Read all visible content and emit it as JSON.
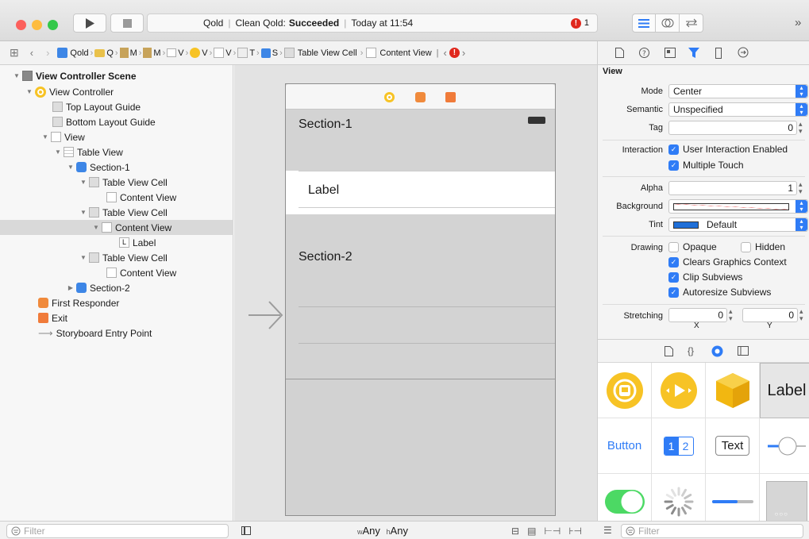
{
  "toolbar": {
    "scheme": "Qold",
    "status_prefix": "Clean Qold:",
    "status_result": "Succeeded",
    "status_time": "Today at 11:54",
    "error_count": "1",
    "more": "»"
  },
  "jumpbar": {
    "items": [
      "Qold",
      "Q",
      "M",
      "M",
      "V",
      "V",
      "V",
      "T",
      "S",
      "Table View Cell",
      "Content View"
    ]
  },
  "outline": {
    "rows": [
      {
        "label": "View Controller Scene",
        "bold": true
      },
      {
        "label": "View Controller"
      },
      {
        "label": "Top Layout Guide"
      },
      {
        "label": "Bottom Layout Guide"
      },
      {
        "label": "View"
      },
      {
        "label": "Table View"
      },
      {
        "label": "Section-1"
      },
      {
        "label": "Table View Cell"
      },
      {
        "label": "Content View"
      },
      {
        "label": "Table View Cell"
      },
      {
        "label": "Content View"
      },
      {
        "label": "Label"
      },
      {
        "label": "Table View Cell"
      },
      {
        "label": "Content View"
      },
      {
        "label": "Section-2"
      },
      {
        "label": "First Responder"
      },
      {
        "label": "Exit"
      },
      {
        "label": "Storyboard Entry Point"
      }
    ],
    "filter_placeholder": "Filter"
  },
  "canvas": {
    "section1": "Section-1",
    "cell_label": "Label",
    "section2": "Section-2",
    "size_class_w": "w",
    "size_class_w_value": "Any",
    "size_class_h": "h",
    "size_class_h_value": "Any"
  },
  "inspector": {
    "header": "View",
    "mode_label": "Mode",
    "mode_value": "Center",
    "semantic_label": "Semantic",
    "semantic_value": "Unspecified",
    "tag_label": "Tag",
    "tag_value": "0",
    "interaction_label": "Interaction",
    "user_interaction": "User Interaction Enabled",
    "multiple_touch": "Multiple Touch",
    "alpha_label": "Alpha",
    "alpha_value": "1",
    "background_label": "Background",
    "tint_label": "Tint",
    "tint_value": "Default",
    "drawing_label": "Drawing",
    "opaque": "Opaque",
    "hidden": "Hidden",
    "clears": "Clears Graphics Context",
    "clip": "Clip Subviews",
    "autoresize": "Autoresize Subviews",
    "stretching_label": "Stretching",
    "stretch_x": "0",
    "stretch_y": "0",
    "x_caption": "X",
    "y_caption": "Y"
  },
  "library": {
    "label_item": "Label",
    "button_item": "Button",
    "seg_1": "1",
    "seg_2": "2",
    "text_item": "Text",
    "filter_placeholder": "Filter"
  },
  "colors": {
    "accent": "#2f7cf6",
    "close": "#fc605c",
    "minimize": "#fdbc40",
    "zoom": "#34c84a",
    "vc_yellow": "#f7c325",
    "responder_orange": "#f08a3c",
    "switch_green": "#4cd964"
  }
}
